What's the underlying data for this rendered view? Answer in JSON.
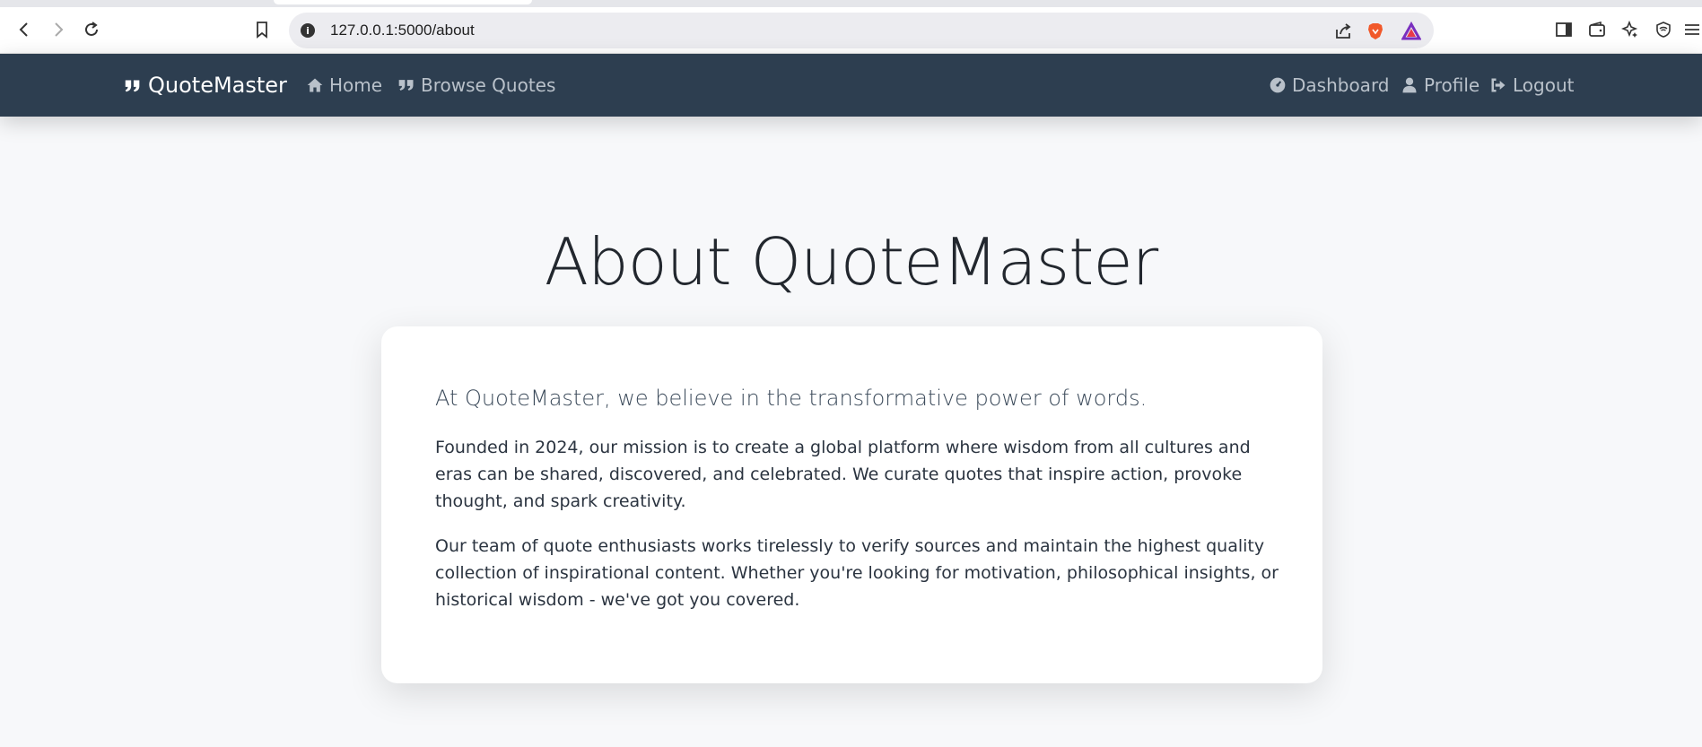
{
  "browser": {
    "url": "127.0.0.1:5000/about",
    "back_icon": "back-arrow-icon",
    "forward_icon": "forward-arrow-icon",
    "reload_icon": "reload-icon",
    "bookmark_icon": "bookmark-icon",
    "share_icon": "share-icon",
    "brave_icon": "brave-lion-icon",
    "rewards_icon": "brave-rewards-triangle-icon",
    "colors": {
      "toolbar": "#ffffff",
      "omnibox": "#ececf0",
      "brave": "#f1582a"
    }
  },
  "navbar": {
    "brand": "QuoteMaster",
    "home": "Home",
    "browse": "Browse Quotes",
    "dashboard": "Dashboard",
    "profile": "Profile",
    "logout": "Logout",
    "colors": {
      "background": "#2d3e50",
      "link": "#b9c1ca",
      "brand": "#ffffff"
    }
  },
  "main": {
    "title": "About QuoteMaster",
    "lead": "At QuoteMaster, we believe in the transformative power of words.",
    "paragraph1": "Founded in 2024, our mission is to create a global platform where wisdom from all cultures and eras can be shared, discovered, and celebrated. We curate quotes that inspire action, provoke thought, and spark creativity.",
    "paragraph2": "Our team of quote enthusiasts works tirelessly to verify sources and maintain the highest quality collection of inspirational content. Whether you're looking for motivation, philosophical insights, or historical wisdom - we've got you covered."
  }
}
